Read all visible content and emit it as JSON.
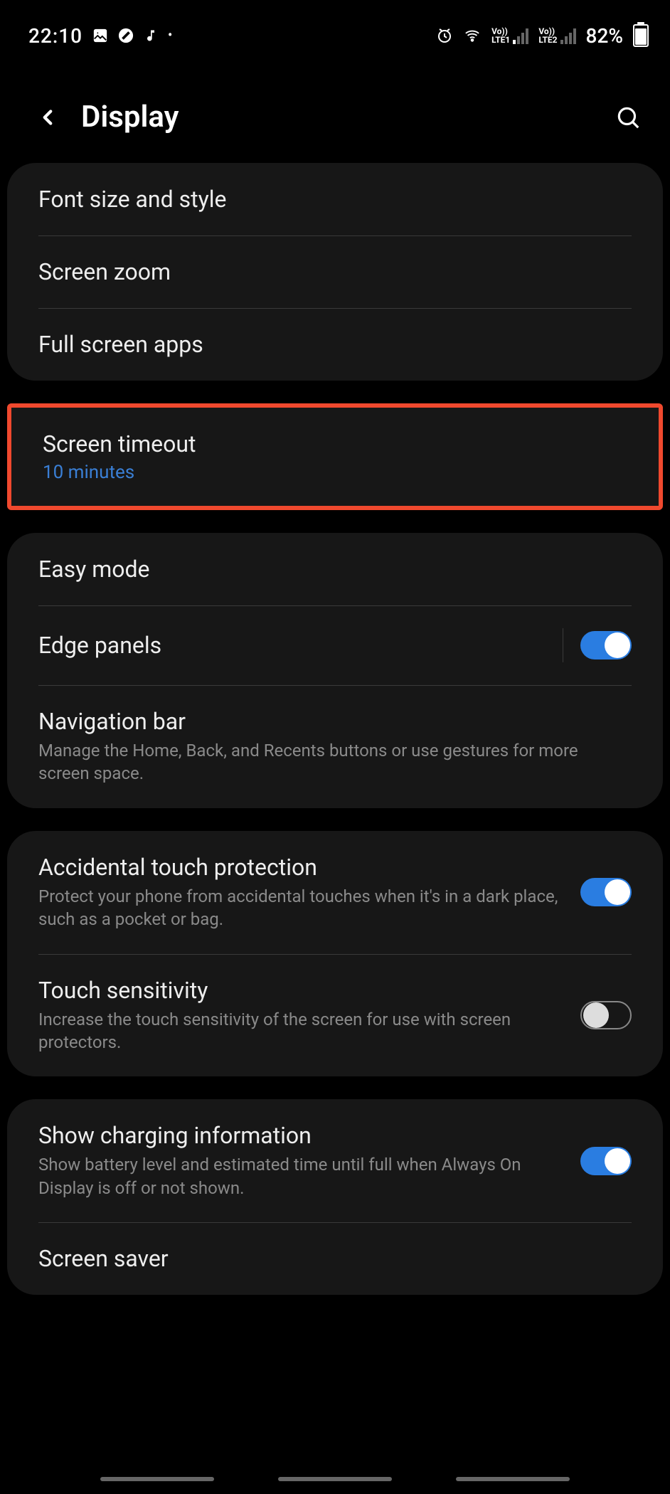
{
  "status": {
    "time": "22:10",
    "lte1": "LTE1",
    "lte2": "LTE2",
    "vo1": "Vo))",
    "vo2": "Vo))",
    "battery_pct": "82%",
    "battery_fill_pct": 82
  },
  "header": {
    "title": "Display"
  },
  "groups": {
    "g1": {
      "font_size_style": "Font size and style",
      "screen_zoom": "Screen zoom",
      "full_screen_apps": "Full screen apps"
    },
    "g2": {
      "screen_timeout": "Screen timeout",
      "screen_timeout_value": "10 minutes"
    },
    "g3": {
      "easy_mode": "Easy mode",
      "edge_panels": "Edge panels",
      "nav_bar": "Navigation bar",
      "nav_bar_sub": "Manage the Home, Back, and Recents buttons or use gestures for more screen space."
    },
    "g4": {
      "accidental": "Accidental touch protection",
      "accidental_sub": "Protect your phone from accidental touches when it's in a dark place, such as a pocket or bag.",
      "touch_sensitivity": "Touch sensitivity",
      "touch_sensitivity_sub": "Increase the touch sensitivity of the screen for use with screen protectors."
    },
    "g5": {
      "charging_info": "Show charging information",
      "charging_info_sub": "Show battery level and estimated time until full when Always On Display is off or not shown.",
      "screen_saver": "Screen saver"
    }
  },
  "toggles": {
    "edge_panels": true,
    "accidental": true,
    "touch_sensitivity": false,
    "charging_info": true
  }
}
